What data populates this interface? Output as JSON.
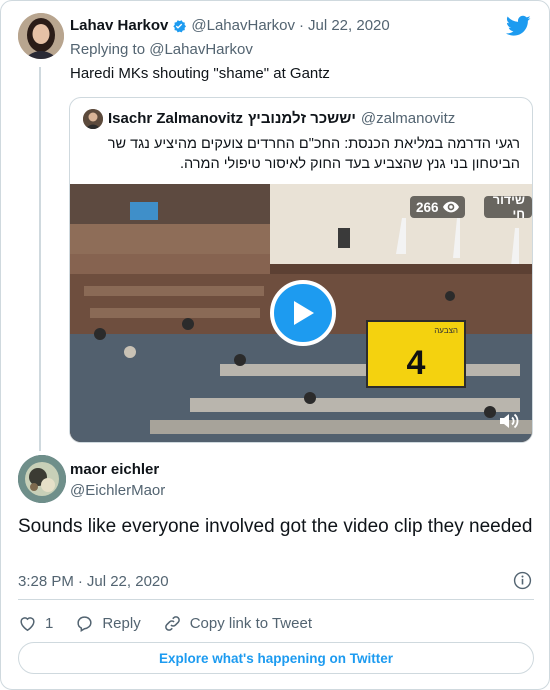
{
  "parent_tweet": {
    "name": "Lahav Harkov",
    "handle": "@LahavHarkov",
    "separator": "·",
    "date": "Jul 22, 2020",
    "replying_prefix": "Replying to",
    "replying_to": "@LahavHarkov",
    "text": "Haredi MKs shouting \"shame\" at Gantz"
  },
  "quoted_tweet": {
    "name": "Isachr Zalmanovitz",
    "name_hebrew": "יששכר זלמנוביץ",
    "handle": "@zalmanovitz",
    "text": "רגעי הדרמה במליאת הכנסת: החכ\"ם החרדים צועקים מהיציע נגד שר הביטחון בני גנץ שהצביע בעד החוק לאיסור טיפולי המרה.",
    "media": {
      "view_count": "266",
      "live_label": "שידור חי",
      "sign_label": "הצבעה",
      "sign_number": "4"
    }
  },
  "reply_tweet": {
    "name": "maor eichler",
    "handle": "@EichlerMaor",
    "text": "Sounds like everyone involved got the video clip they needed",
    "time": "3:28 PM",
    "separator": "·",
    "date": "Jul 22, 2020"
  },
  "actions": {
    "like_count": "1",
    "reply_label": "Reply",
    "copy_link_label": "Copy link to Tweet"
  },
  "footer": {
    "explore_label": "Explore what's happening on Twitter"
  },
  "colors": {
    "brand_blue": "#1d9bf0",
    "text_primary": "#0f1419",
    "text_secondary": "#536471",
    "border": "#cfd9de"
  },
  "icons": [
    "verified-badge-icon",
    "twitter-bird-icon",
    "play-icon",
    "eye-icon",
    "speaker-icon",
    "info-icon",
    "heart-icon",
    "reply-icon",
    "link-icon"
  ]
}
